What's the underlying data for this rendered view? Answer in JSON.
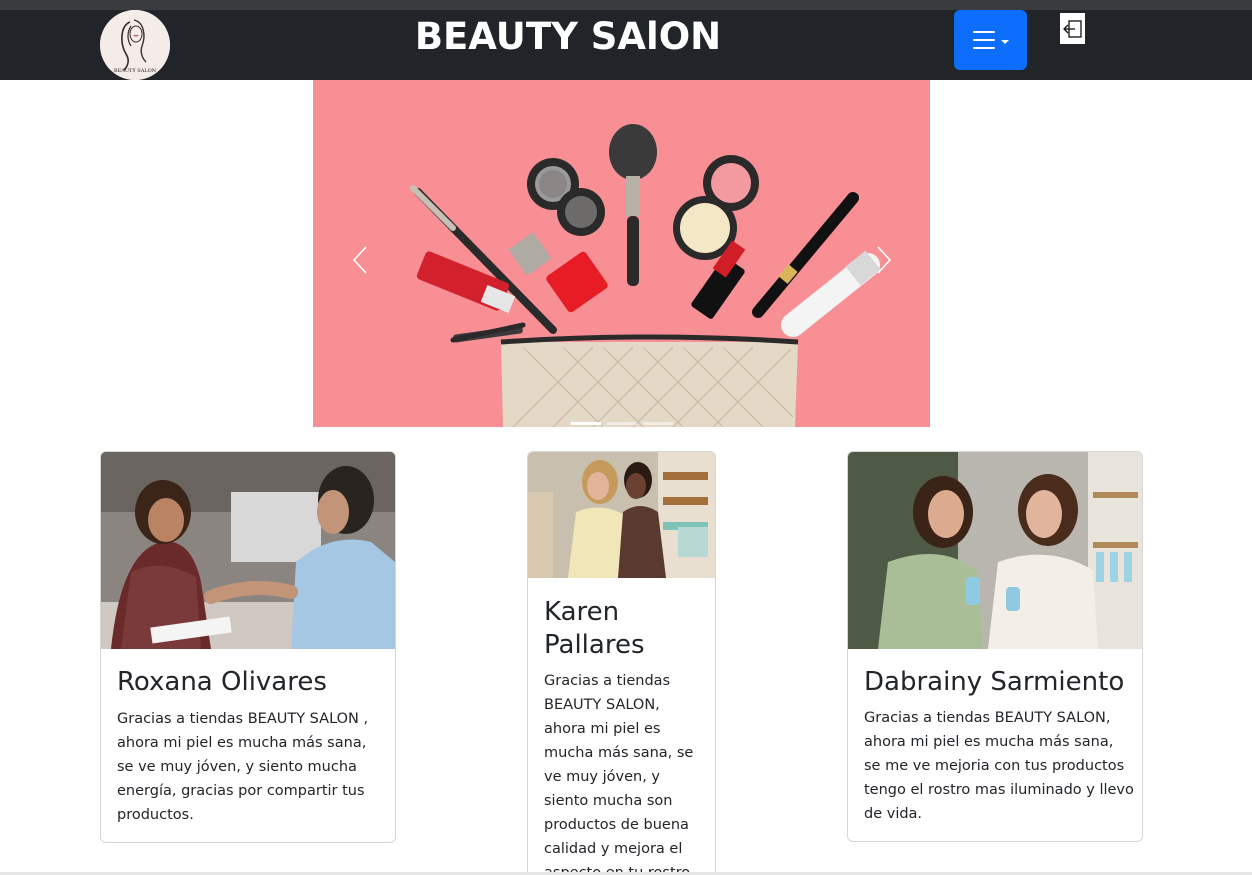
{
  "navbar": {
    "logo_text": "BEAUTY SALON",
    "brand": "BEAUTY SAlON",
    "menu_icon": "hamburger-icon",
    "logout_icon": "logout-icon"
  },
  "carousel": {
    "slides": 3,
    "active_slide": 1,
    "prev_icon": "chevron-left-icon",
    "next_icon": "chevron-right-icon"
  },
  "testimonials": [
    {
      "name": "Roxana Olivares",
      "text": "Gracias a tiendas BEAUTY SALON , ahora mi piel es mucha más sana, se ve muy jóven, y siento mucha energía, gracias por compartir tus productos."
    },
    {
      "name": "Karen Pallares",
      "text": "Gracias a tiendas BEAUTY SALON, ahora mi piel es mucha más sana, se ve muy jóven, y siento mucha son productos de buena calidad y mejora el aspecto en tu rostro"
    },
    {
      "name": "Dabrainy Sarmiento",
      "text": "Gracias a tiendas BEAUTY SALON, ahora mi piel es mucha más sana, se me ve mejoria con tus productos tengo el rostro mas iluminado y llevo de vida."
    }
  ],
  "colors": {
    "navbar": "#212529",
    "menu_button": "#0d6efd",
    "carousel_bg": "#f78f95"
  }
}
